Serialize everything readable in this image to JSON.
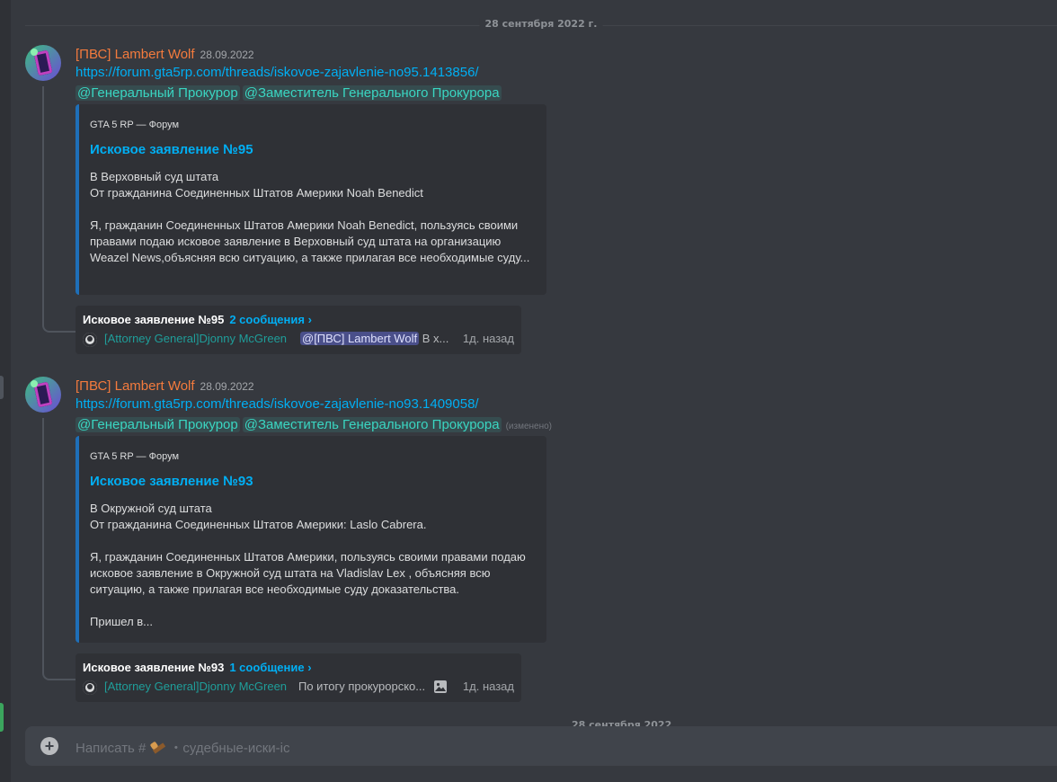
{
  "date_divider": "28 сентября 2022 г.",
  "messages": [
    {
      "username": "[ПВС] Lambert Wolf",
      "timestamp": "28.09.2022",
      "link": "https://forum.gta5rp.com/threads/iskovoe-zajavlenie-no95.1413856/",
      "mentions": [
        "@Генеральный Прокурор",
        "@Заместитель Генерального Прокурора"
      ],
      "edited": "",
      "embed": {
        "provider": "GTA 5 RP — Форум",
        "title": "Исковое заявление №95",
        "description": "В Верховный суд штата\nОт гражданина Соединенных Штатов Америки Noah Benedict\n\nЯ, гражданин Соединенных Штатов Америки Noah Benedict, пользуясь своими правами подаю исковое заявление в Верховный суд штата на организацию Weazel News,объясняя всю ситуацию, а также прилагая все необходимые суду..."
      },
      "thread": {
        "name": "Исковое заявление №95",
        "count": "2 сообщения ›",
        "author": "[Attorney General]Djonny McGreen",
        "mention": "@[ПВС] Lambert Wolf",
        "preview": " В х...",
        "time": "1д. назад"
      }
    },
    {
      "username": "[ПВС] Lambert Wolf",
      "timestamp": "28.09.2022",
      "link": "https://forum.gta5rp.com/threads/iskovoe-zajavlenie-no93.1409058/",
      "mentions": [
        "@Генеральный Прокурор",
        "@Заместитель Генерального Прокурора"
      ],
      "edited": "(изменено)",
      "embed": {
        "provider": "GTA 5 RP — Форум",
        "title": "Исковое заявление №93",
        "description": "В Окружной суд штата\nОт гражданина Соединенных Штатов Америки: Laslo Cabrera.\n\nЯ, гражданин Соединенных Штатов Америки, пользуясь своими правами подаю исковое заявление в Окружной суд штата на Vladislav Lex , объясняя всю ситуацию, а также прилагая все необходимые суду доказательства.\n\nПришел в..."
      },
      "thread": {
        "name": "Исковое заявление №93",
        "count": "1 сообщение ›",
        "author": "[Attorney General]Djonny McGreen",
        "preview": "По итогу прокурорско...",
        "time": "1д. назад"
      }
    }
  ],
  "partial_date": "28 сентября 2022",
  "composer": {
    "prefix": "Написать #",
    "channel": "・судебные-иски-ic"
  },
  "icons": {
    "plus": "plus-circle-icon",
    "image": "image-icon",
    "channel_emoji": "hammer-emoji-icon"
  }
}
